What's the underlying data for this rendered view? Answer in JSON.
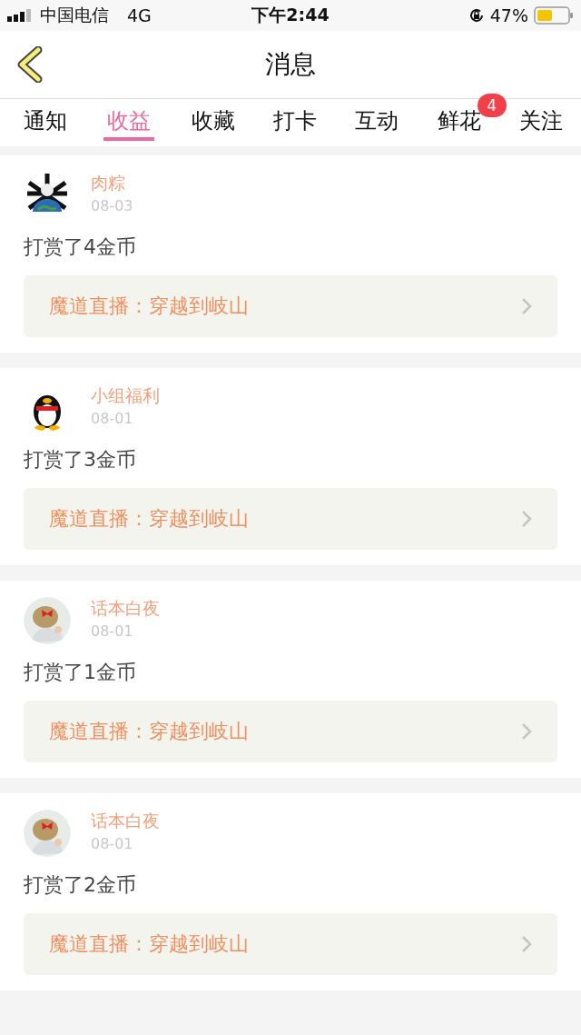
{
  "status_bar": {
    "carrier": "中国电信",
    "network": "4G",
    "time": "下午2:44",
    "battery": "47%"
  },
  "nav": {
    "title": "消息"
  },
  "tabs": [
    {
      "label": "通知",
      "selected": false
    },
    {
      "label": "收益",
      "selected": true
    },
    {
      "label": "收藏",
      "selected": false
    },
    {
      "label": "打卡",
      "selected": false
    },
    {
      "label": "互动",
      "selected": false
    },
    {
      "label": "鲜花",
      "selected": false,
      "badge": "4"
    },
    {
      "label": "关注",
      "selected": false
    }
  ],
  "messages": [
    {
      "name": "肉粽",
      "date": "08-03",
      "text": "打赏了4金币",
      "link": "魔道直播：穿越到岐山"
    },
    {
      "name": "小组福利",
      "date": "08-01",
      "text": "打赏了3金币",
      "link": "魔道直播：穿越到岐山"
    },
    {
      "name": "话本白夜",
      "date": "08-01",
      "text": "打赏了1金币",
      "link": "魔道直播：穿越到岐山"
    },
    {
      "name": "话本白夜",
      "date": "08-01",
      "text": "打赏了2金币",
      "link": "魔道直播：穿越到岐山"
    }
  ]
}
